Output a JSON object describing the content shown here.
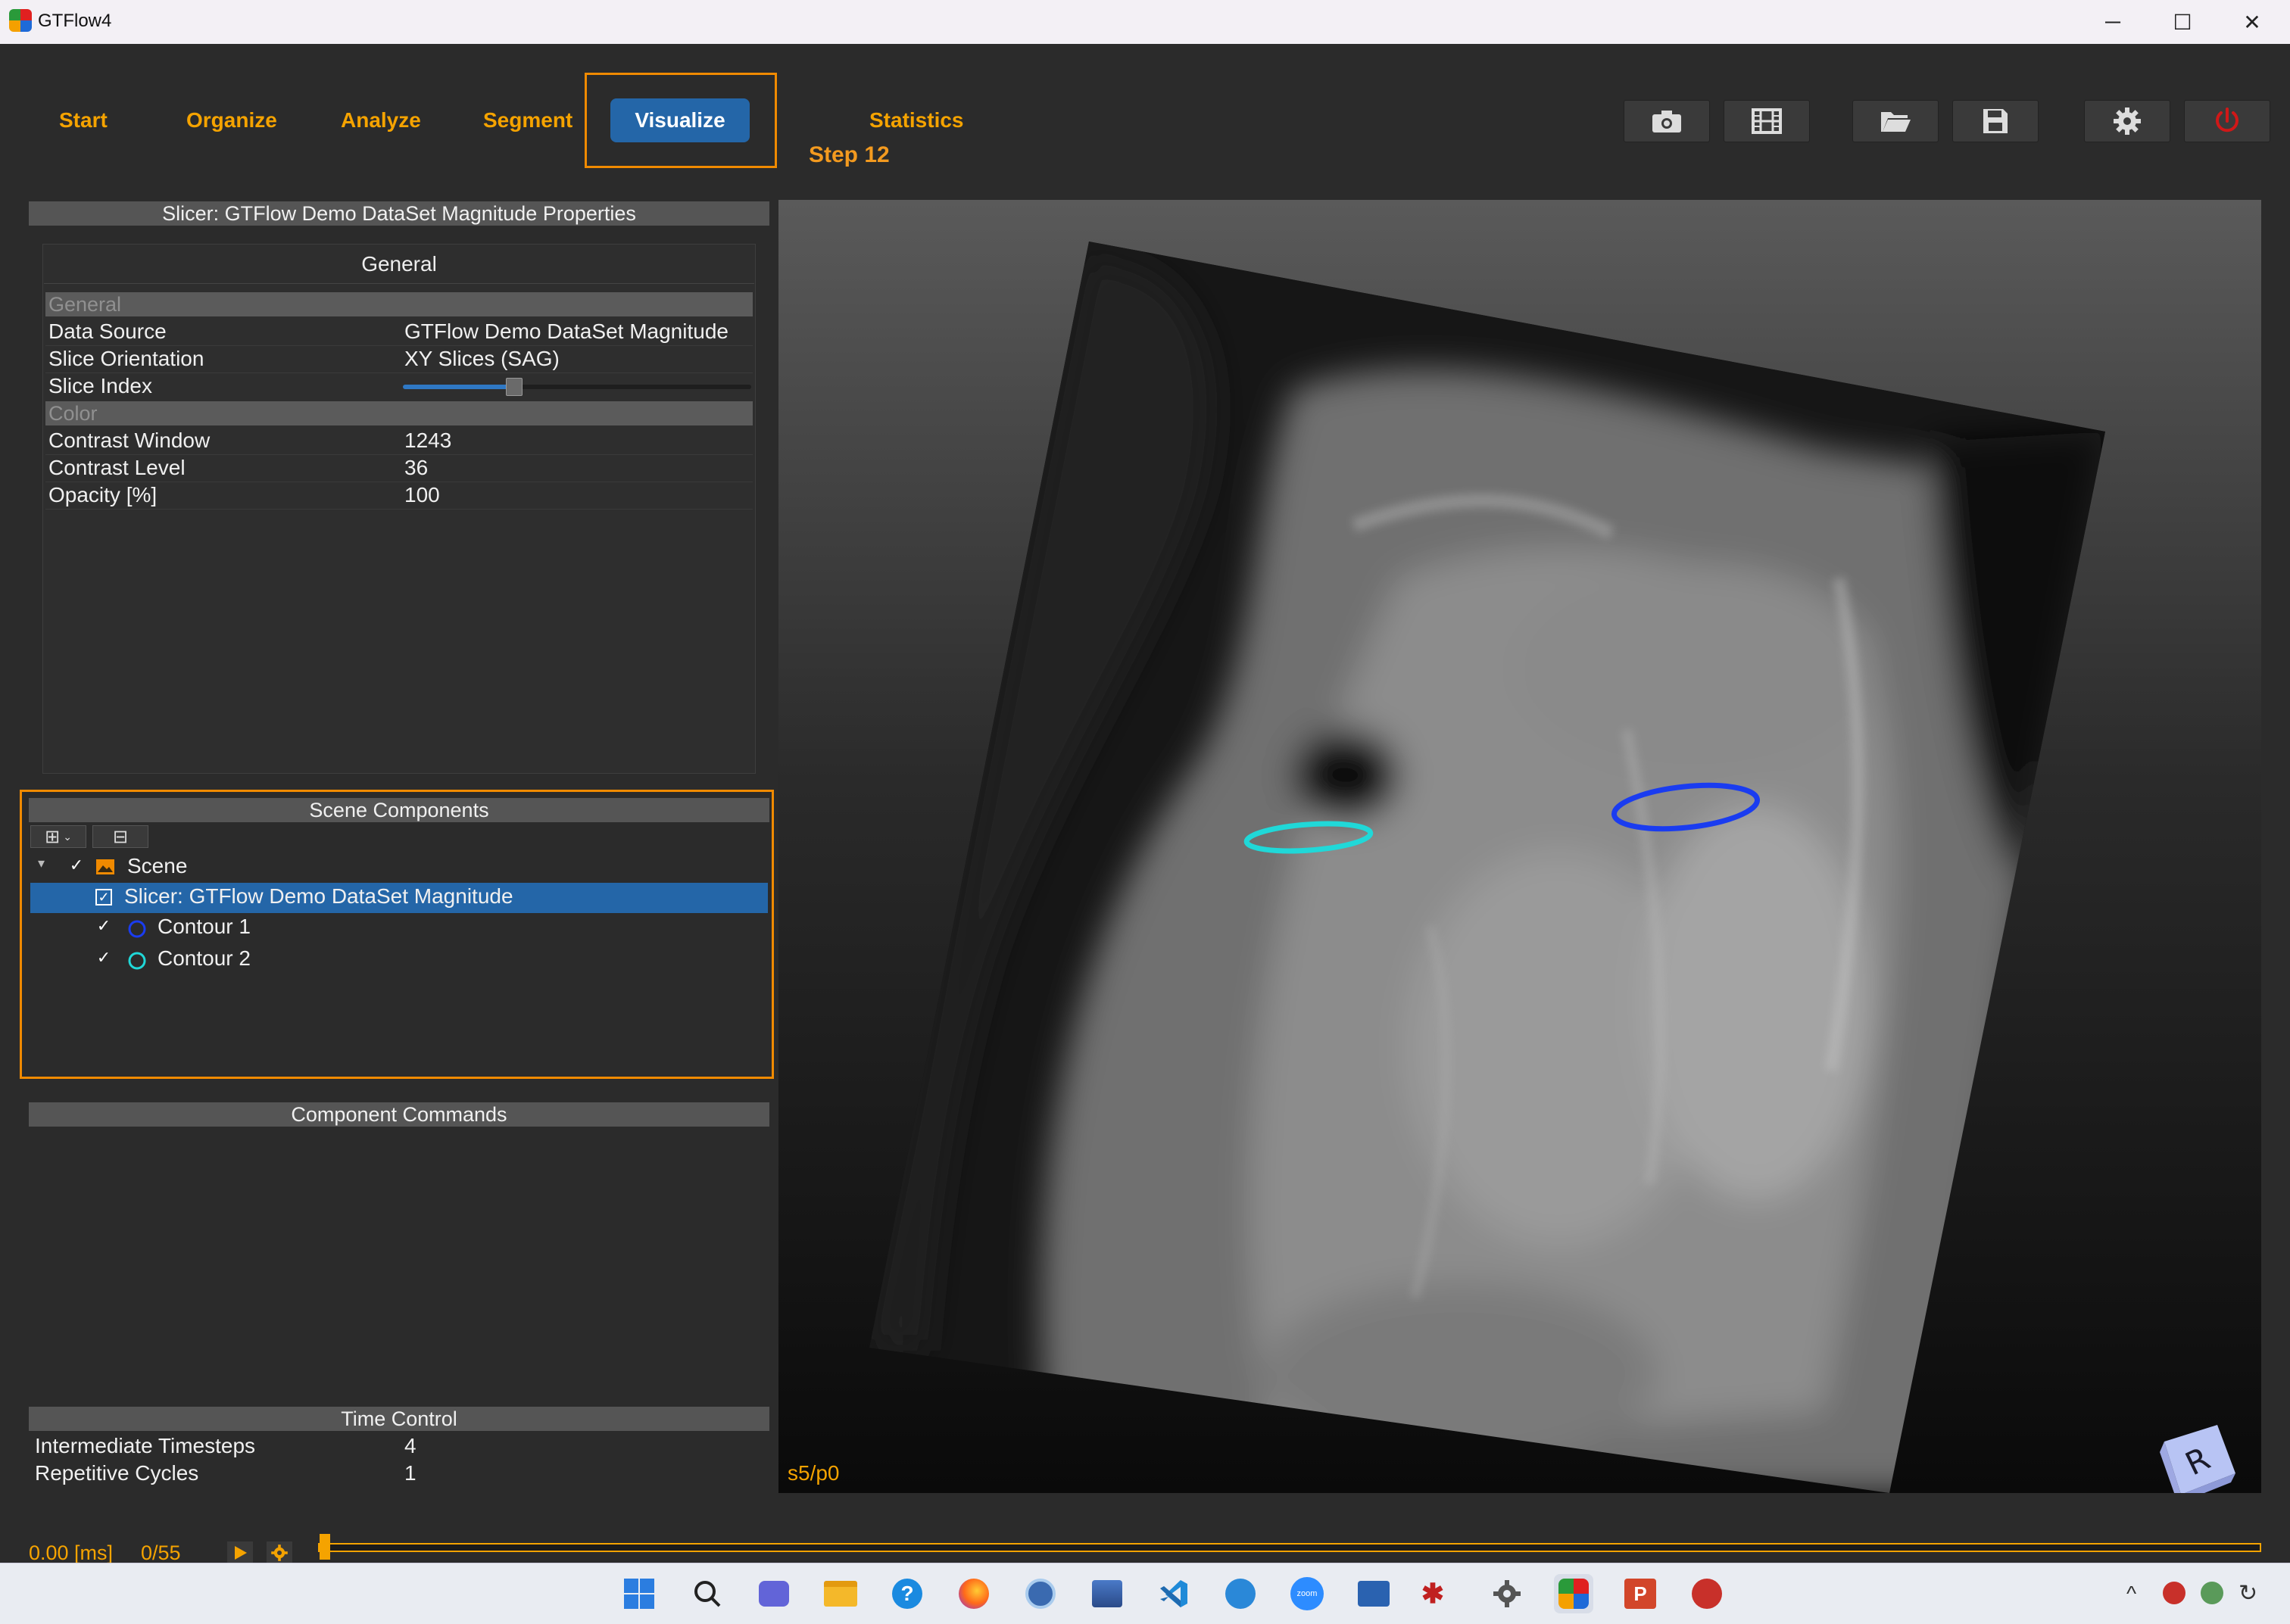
{
  "window": {
    "title": "GTFlow4",
    "controls": {
      "minimize": "─",
      "maximize": "☐",
      "close": "✕"
    }
  },
  "nav": {
    "items": [
      "Start",
      "Organize",
      "Analyze",
      "Segment",
      "Visualize",
      "Statistics"
    ],
    "active": "Visualize",
    "step_label": "Step 12"
  },
  "toolbar": {
    "icons": [
      "camera-icon",
      "film-icon",
      "folder-open-icon",
      "save-icon",
      "gear-icon",
      "power-icon"
    ]
  },
  "properties": {
    "header": "Slicer: GTFlow Demo DataSet Magnitude Properties",
    "tab": "General",
    "groups": {
      "general": "General",
      "color": "Color"
    },
    "rows": {
      "data_source": {
        "label": "Data Source",
        "value": "GTFlow Demo DataSet Magnitude"
      },
      "slice_orientation": {
        "label": "Slice Orientation",
        "value": "XY Slices (SAG)"
      },
      "slice_index": {
        "label": "Slice Index",
        "fraction": 0.32
      },
      "contrast_window": {
        "label": "Contrast Window",
        "value": "1243"
      },
      "contrast_level": {
        "label": "Contrast Level",
        "value": "36"
      },
      "opacity": {
        "label": "Opacity [%]",
        "value": "100"
      }
    }
  },
  "scene": {
    "header": "Scene Components",
    "expand_button": "⊞",
    "collapse_button": "⊟",
    "root": {
      "label": "Scene",
      "checked": true
    },
    "items": [
      {
        "label": "Slicer: GTFlow Demo DataSet Magnitude",
        "checked": true,
        "selected": true
      },
      {
        "label": "Contour 1",
        "checked": true,
        "color": "#1a3cf0"
      },
      {
        "label": "Contour 2",
        "checked": true,
        "color": "#20d8d8"
      }
    ]
  },
  "commands": {
    "header": "Component Commands"
  },
  "time_control": {
    "header": "Time Control",
    "intermediate_timesteps": {
      "label": "Intermediate Timesteps",
      "value": "4"
    },
    "repetitive_cycles": {
      "label": "Repetitive Cycles",
      "value": "1"
    }
  },
  "viewport": {
    "label": "s5/p0",
    "orientation_cube_label": "R"
  },
  "timeline": {
    "time": "0.00 [ms]",
    "frame": "0/55",
    "position_fraction": 0.0
  },
  "colors": {
    "accent_orange": "#f5a300",
    "nav_active_bg": "#2466a8",
    "contour_1": "#1a3cf0",
    "contour_2": "#20d8d8"
  }
}
